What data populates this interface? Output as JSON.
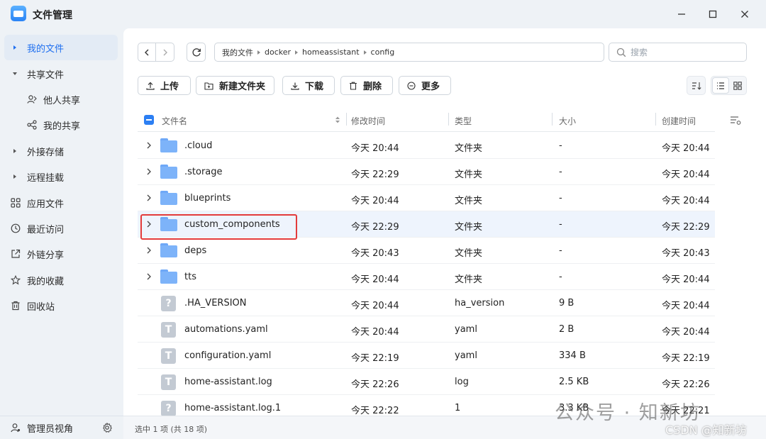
{
  "app": {
    "title": "文件管理"
  },
  "sidebar": {
    "items": [
      {
        "label": "我的文件",
        "icon": "caret-right-icon",
        "active": true
      },
      {
        "label": "共享文件",
        "icon": "caret-down-icon"
      },
      {
        "label": "他人共享",
        "icon": "person-share-icon",
        "sub": true
      },
      {
        "label": "我的共享",
        "icon": "share-icon",
        "sub": true
      },
      {
        "label": "外接存储",
        "icon": "caret-right-icon"
      },
      {
        "label": "远程挂载",
        "icon": "caret-right-icon"
      },
      {
        "label": "应用文件",
        "icon": "apps-icon"
      },
      {
        "label": "最近访问",
        "icon": "clock-icon"
      },
      {
        "label": "外链分享",
        "icon": "external-link-icon"
      },
      {
        "label": "我的收藏",
        "icon": "star-icon"
      },
      {
        "label": "回收站",
        "icon": "trash-icon"
      }
    ],
    "footer": {
      "label": "管理员视角"
    }
  },
  "breadcrumb": [
    "我的文件",
    "docker",
    "homeassistant",
    "config"
  ],
  "search": {
    "placeholder": "搜索",
    "value": ""
  },
  "toolbar": {
    "upload": "上传",
    "new_folder": "新建文件夹",
    "download": "下载",
    "delete": "删除",
    "more": "更多"
  },
  "table": {
    "columns": {
      "name": "文件名",
      "modified": "修改时间",
      "type": "类型",
      "size": "大小",
      "created": "创建时间"
    },
    "rows": [
      {
        "name": ".cloud",
        "modified": "今天 20:44",
        "type": "文件夹",
        "size": "-",
        "created": "今天 20:44",
        "kind": "folder"
      },
      {
        "name": ".storage",
        "modified": "今天 22:29",
        "type": "文件夹",
        "size": "-",
        "created": "今天 20:44",
        "kind": "folder"
      },
      {
        "name": "blueprints",
        "modified": "今天 20:44",
        "type": "文件夹",
        "size": "-",
        "created": "今天 20:44",
        "kind": "folder"
      },
      {
        "name": "custom_components",
        "modified": "今天 22:29",
        "type": "文件夹",
        "size": "-",
        "created": "今天 22:29",
        "kind": "folder",
        "selected": true
      },
      {
        "name": "deps",
        "modified": "今天 20:43",
        "type": "文件夹",
        "size": "-",
        "created": "今天 20:43",
        "kind": "folder"
      },
      {
        "name": "tts",
        "modified": "今天 20:44",
        "type": "文件夹",
        "size": "-",
        "created": "今天 20:44",
        "kind": "folder"
      },
      {
        "name": ".HA_VERSION",
        "modified": "今天 20:44",
        "type": "ha_version",
        "size": "9 B",
        "created": "今天 20:44",
        "kind": "unknown",
        "glyph": "?"
      },
      {
        "name": "automations.yaml",
        "modified": "今天 20:44",
        "type": "yaml",
        "size": "2 B",
        "created": "今天 20:44",
        "kind": "text",
        "glyph": "T"
      },
      {
        "name": "configuration.yaml",
        "modified": "今天 22:19",
        "type": "yaml",
        "size": "334 B",
        "created": "今天 22:19",
        "kind": "text",
        "glyph": "T"
      },
      {
        "name": "home-assistant.log",
        "modified": "今天 22:26",
        "type": "log",
        "size": "2.5 KB",
        "created": "今天 22:26",
        "kind": "text",
        "glyph": "T"
      },
      {
        "name": "home-assistant.log.1",
        "modified": "今天 22:22",
        "type": "1",
        "size": "3.3 KB",
        "created": "今天 22:21",
        "kind": "unknown",
        "glyph": "?"
      }
    ]
  },
  "status": {
    "text": "选中 1 项 (共 18 项)"
  },
  "watermark": {
    "line1": "公众号 · 知新坊",
    "line2": "CSDN @知新坊"
  },
  "colors": {
    "accent": "#1f6ff0",
    "folder": "#7db3f9",
    "highlight": "#e33b3b"
  }
}
